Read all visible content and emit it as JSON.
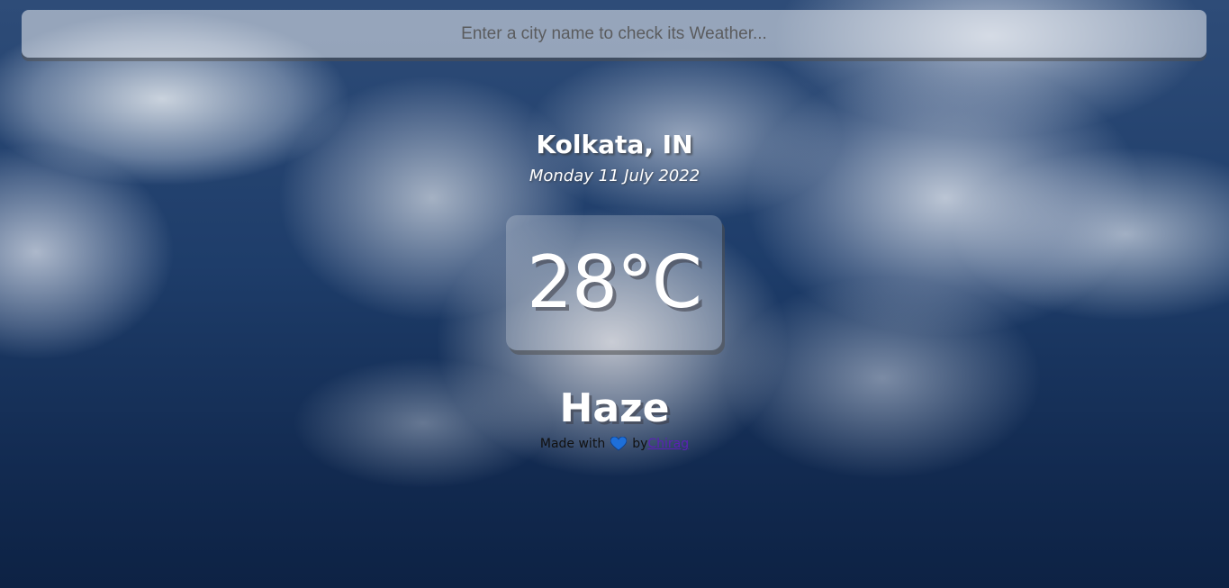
{
  "search": {
    "placeholder": "Enter a city name to check its Weather...",
    "value": ""
  },
  "weather": {
    "location": "Kolkata, IN",
    "date": "Monday 11 July 2022",
    "temperature": "28°C",
    "condition": "Haze"
  },
  "footer": {
    "made_with": "Made with",
    "heart_icon": "heart-icon",
    "by": "by",
    "author": "Chirag"
  },
  "colors": {
    "heart": "#1e6fd9",
    "link": "#5b21b6",
    "text": "#ffffff"
  }
}
